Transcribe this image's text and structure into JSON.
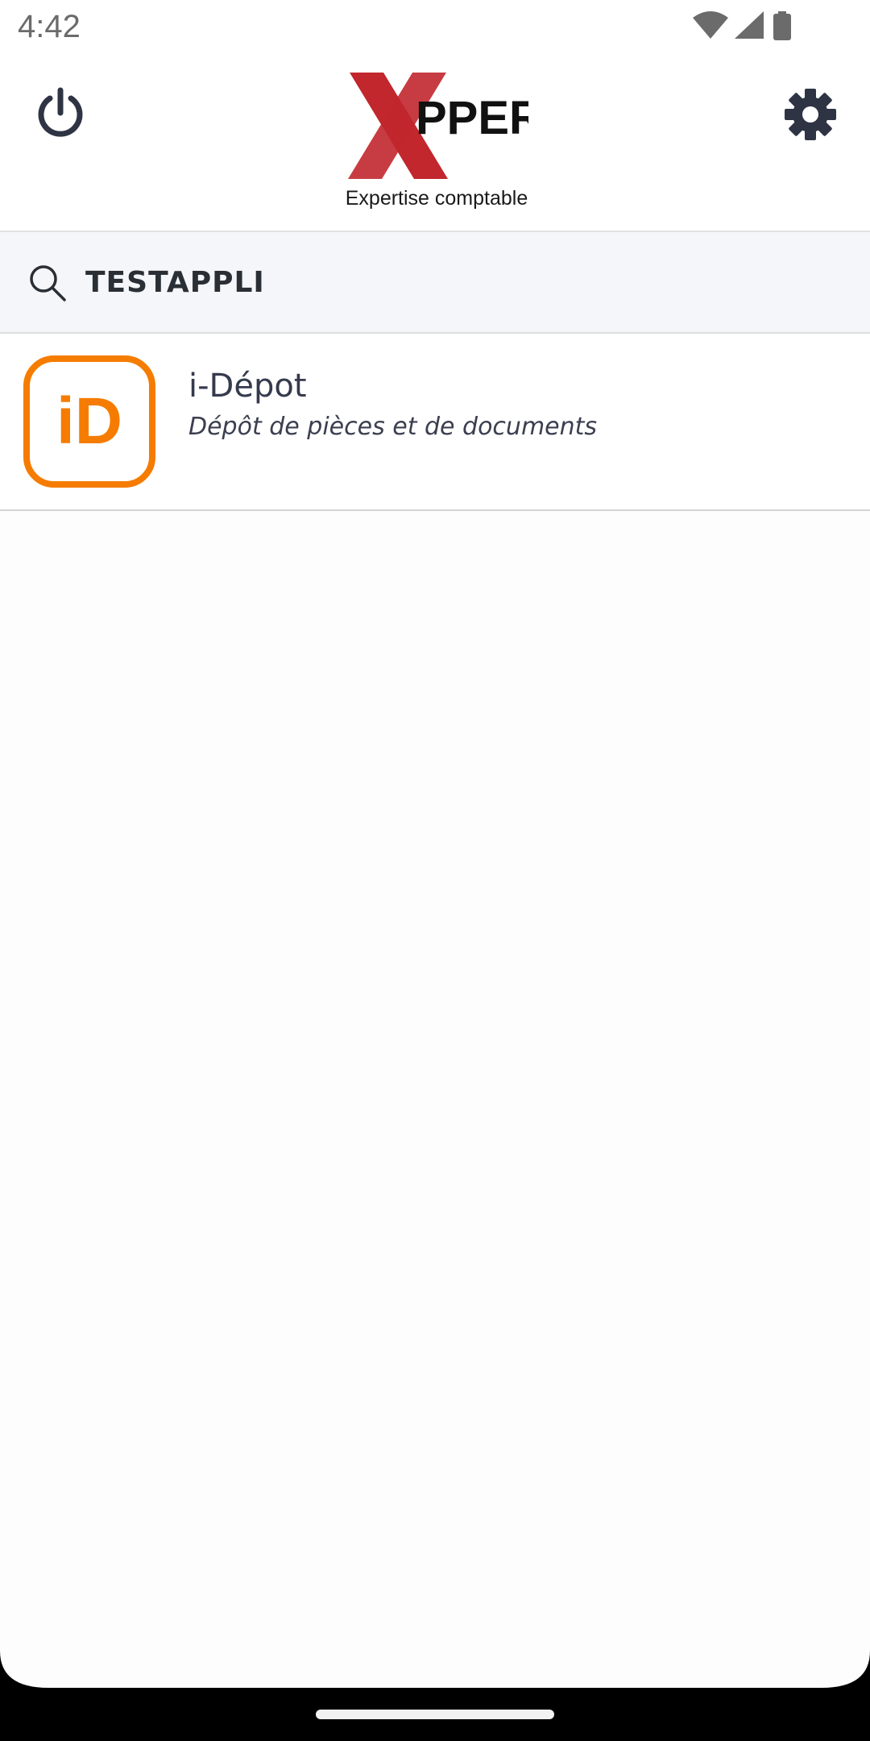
{
  "status_bar": {
    "time": "4:42",
    "icons": [
      "wifi-icon",
      "signal-icon",
      "battery-icon"
    ]
  },
  "header": {
    "logo": {
      "wordmark": "XPPER",
      "caption": "Expertise comptable"
    },
    "left_icon": "power-icon",
    "right_icon": "gear-icon"
  },
  "search": {
    "value": "TESTAPPLI",
    "icon": "search-icon"
  },
  "apps": [
    {
      "icon_text": "iD",
      "title": "i-Dépot",
      "subtitle": "Dépôt de pièces et de documents"
    }
  ],
  "colors": {
    "logo_red": "#c1272d",
    "accent_orange": "#f57c00",
    "icon_dark": "#2f3444"
  }
}
